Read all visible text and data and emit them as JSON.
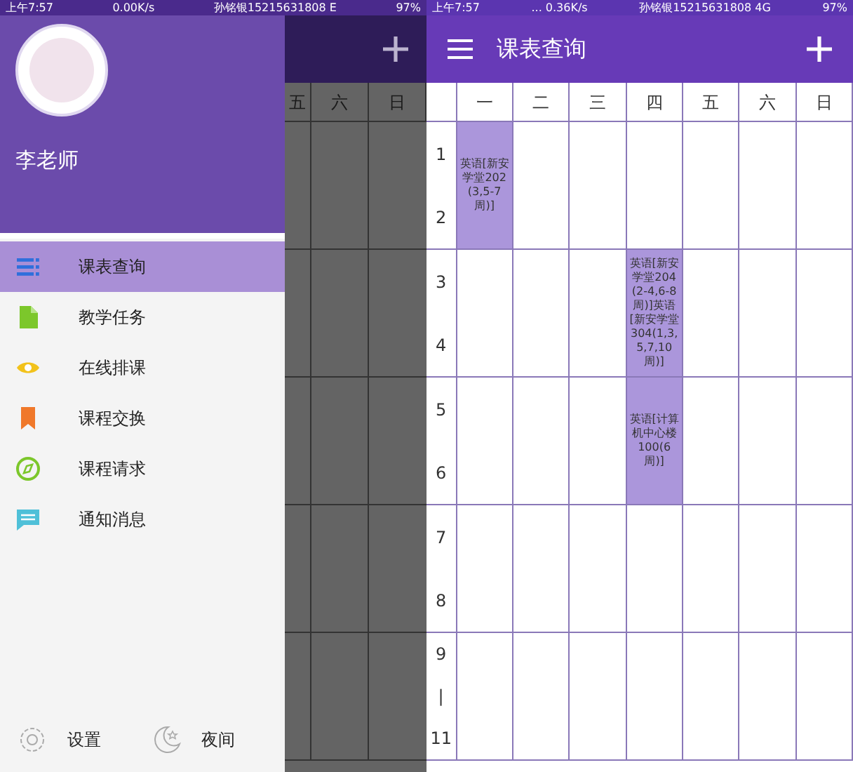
{
  "left_phone": {
    "status_bar": {
      "time": "上午7:57",
      "speed": "0.00K/s",
      "carrier": "孙铭银15215631808 E",
      "battery": "97%"
    },
    "background_columns": [
      "五",
      "六",
      "日"
    ],
    "drawer": {
      "user_name": "李老师",
      "items": [
        {
          "kind": "list",
          "label": "课表查询",
          "selected": true
        },
        {
          "kind": "document",
          "label": "教学任务",
          "selected": false
        },
        {
          "kind": "eye",
          "label": "在线排课",
          "selected": false
        },
        {
          "kind": "bookmark",
          "label": "课程交换",
          "selected": false
        },
        {
          "kind": "compass",
          "label": "课程请求",
          "selected": false
        },
        {
          "kind": "message",
          "label": "通知消息",
          "selected": false
        }
      ],
      "footer": [
        {
          "kind": "settings",
          "label": "设置"
        },
        {
          "kind": "night",
          "label": "夜间"
        }
      ]
    }
  },
  "right_phone": {
    "status_bar": {
      "time": "上午7:57",
      "speed": "... 0.36K/s",
      "carrier": "孙铭银15215631808 4G",
      "battery": "97%"
    },
    "title": "课表查询",
    "days": [
      "一",
      "二",
      "三",
      "四",
      "五",
      "六",
      "日"
    ],
    "slots": [
      {
        "labels": [
          "1",
          "2"
        ],
        "cells": [
          {
            "kind": "course",
            "text": "英语[新安学堂202(3,5-7周)]"
          },
          {
            "kind": "empty"
          },
          {
            "kind": "empty"
          },
          {
            "kind": "empty"
          },
          {
            "kind": "empty"
          },
          {
            "kind": "empty"
          },
          {
            "kind": "empty"
          }
        ]
      },
      {
        "labels": [
          "3",
          "4"
        ],
        "cells": [
          {
            "kind": "empty"
          },
          {
            "kind": "empty"
          },
          {
            "kind": "empty"
          },
          {
            "kind": "course",
            "text": "英语[新安学堂204(2-4,6-8周)]英语[新安学堂304(1,3,5,7,10周)]"
          },
          {
            "kind": "empty"
          },
          {
            "kind": "empty"
          },
          {
            "kind": "empty"
          }
        ]
      },
      {
        "labels": [
          "5",
          "6"
        ],
        "cells": [
          {
            "kind": "empty"
          },
          {
            "kind": "empty"
          },
          {
            "kind": "empty"
          },
          {
            "kind": "course",
            "text": "英语[计算机中心楼100(6周)]"
          },
          {
            "kind": "empty"
          },
          {
            "kind": "empty"
          },
          {
            "kind": "empty"
          }
        ]
      },
      {
        "labels": [
          "7",
          "8"
        ],
        "cells": [
          {
            "kind": "empty"
          },
          {
            "kind": "empty"
          },
          {
            "kind": "empty"
          },
          {
            "kind": "empty"
          },
          {
            "kind": "empty"
          },
          {
            "kind": "empty"
          },
          {
            "kind": "empty"
          }
        ]
      },
      {
        "labels": [
          "9",
          "|",
          "11"
        ],
        "cells": [
          {
            "kind": "empty"
          },
          {
            "kind": "empty"
          },
          {
            "kind": "empty"
          },
          {
            "kind": "empty"
          },
          {
            "kind": "empty"
          },
          {
            "kind": "empty"
          },
          {
            "kind": "empty"
          }
        ]
      }
    ]
  }
}
